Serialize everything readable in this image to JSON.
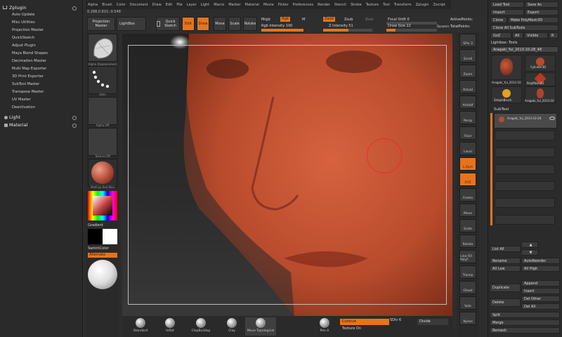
{
  "menubar": [
    "Alpha",
    "Brush",
    "Color",
    "Document",
    "Draw",
    "Edit",
    "File",
    "Layer",
    "Light",
    "Macro",
    "Marker",
    "Material",
    "Movie",
    "Picker",
    "Preferences",
    "Render",
    "Stencil",
    "Stroke",
    "Texture",
    "Tool",
    "Transform",
    "Zplugin",
    "Zscript"
  ],
  "coords": "0.288,0.815,-0.548",
  "plugin": {
    "header": "Zplugin",
    "items": [
      "Auto Update",
      "Misc Utilities",
      "Projection Master",
      "QuickSketch",
      "Adjust Plugin",
      "Maya Blend Shapes",
      "Decimation Master",
      "Multi Map Exporter",
      "3D Print Exporter",
      "SubTool Master",
      "Transpose Master",
      "UV Master",
      "Deactivation"
    ],
    "light": "Light",
    "material": "Material"
  },
  "toolbar": {
    "projection_master": "Projection Master",
    "lightbox": "LightBox",
    "quick_sketch": "Quick Sketch",
    "edit": "Edit",
    "draw": "Draw",
    "move": "Move",
    "scale": "Scale",
    "rotate": "Rotate",
    "mrgb": "Mrgb",
    "rgb": "Rgb",
    "m": "M",
    "rgb_intensity": "Rgb Intensity 100",
    "zadd": "Zadd",
    "zsub": "Zsub",
    "zcut": "Zcut",
    "z_intensity": "Z Intensity 51",
    "focal_shift": "Focal Shift 0",
    "draw_size": "Draw Size 22",
    "dynamic": "Dynamic",
    "active_points": "ActivePoints:",
    "total_points": "TotalPoints:",
    "rgb_intensity_fill": 1.0,
    "z_intensity_fill": 0.51,
    "draw_size_fill": 0.18,
    "accent": "#e8731b"
  },
  "leftcol": {
    "captions": [
      "Alpha Displacement",
      "Dots",
      "Alpha Off",
      "Texture Off",
      "MatCap Red Wax"
    ],
    "gradient": "Gradient",
    "switchcolor": "SwitchColor",
    "alternate": "Alternate"
  },
  "bottom": {
    "brushes": [
      "Standard",
      "Inflat",
      "ClayBuildup",
      "Clay",
      "Move Topological",
      "Pen A"
    ],
    "colorize": "Colorize",
    "sdiv": "SDiv 6",
    "divide": "Divide",
    "texture_on": "Texture On"
  },
  "rightbar": [
    "SPix 3",
    "Scroll",
    "Zoom",
    "Actual",
    "AAHalf",
    "Persp",
    "Floor",
    "Local",
    "L.Sym",
    "XYZ",
    "Frame",
    "Move",
    "Scale",
    "Rotate",
    "Line Fill PolyF",
    "Transp",
    "Ghost",
    "Solo",
    "Xpose"
  ],
  "rpanel": {
    "load_tool": "Load Tool",
    "save_as": "Save As",
    "import": "Import",
    "export": "Export",
    "clone": "Clone",
    "make_polymesh": "Make PolyMesh3D",
    "clone_all": "Clone All SubTools",
    "goz": "GoZ",
    "all": "All",
    "visible": "Visible",
    "r": "R",
    "lightbox_tools": "Lightbox› Tools",
    "tool_name": "Aragaki_Yui_2013-10-28_48",
    "tools": [
      "Aragaki_Yui_2013-10",
      "Cylinder3D",
      "PolyMesh3D",
      "SimpleBrush",
      "Aragaki_Yui_2013-10"
    ],
    "subtool": "SubTool",
    "subtool_name": "Aragaki_Yui_2013-10-28",
    "list_all": "List All",
    "rename": "Rename",
    "auto_reorder": "AutoReorder",
    "all_low": "All Low",
    "all_high": "All High",
    "duplicate": "Duplicate",
    "append": "Append",
    "insert": "Insert",
    "delete": "Delete",
    "del_other": "Del Other",
    "del_all": "Del All",
    "split": "Split",
    "merge": "Merge",
    "remesh": "Remesh"
  }
}
